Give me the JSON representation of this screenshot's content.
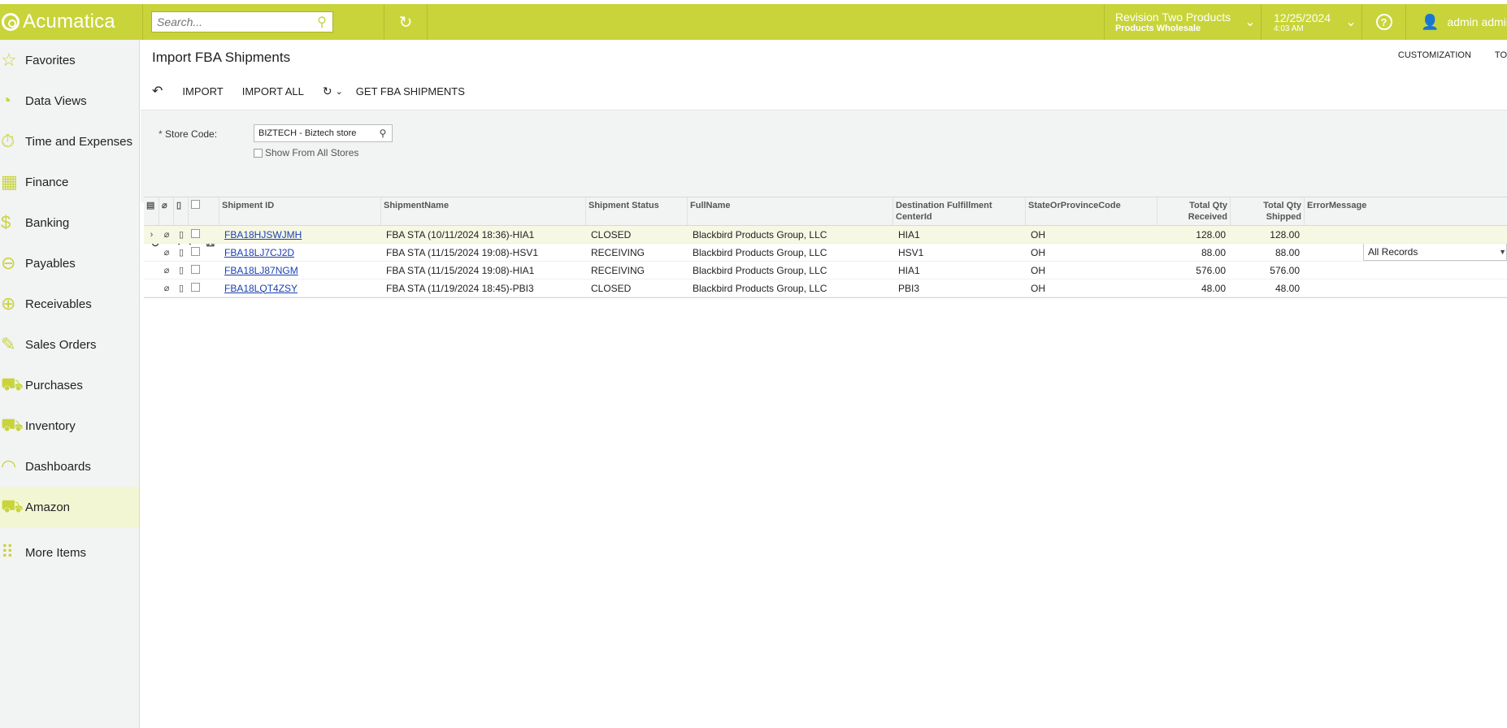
{
  "topbar": {
    "logo": "Acumatica",
    "search_placeholder": "Search...",
    "company": {
      "name": "Revision Two Products",
      "branch": "Products Wholesale"
    },
    "date": {
      "date": "12/25/2024",
      "time": "4:03 AM"
    },
    "user": "admin admin"
  },
  "sidebar": {
    "items": [
      {
        "label": "Favorites",
        "icon": "star-icon",
        "glyph": "☆"
      },
      {
        "label": "Data Views",
        "icon": "pie-chart-icon",
        "glyph": "◔"
      },
      {
        "label": "Time and Expenses",
        "icon": "stopwatch-icon",
        "glyph": "⏱"
      },
      {
        "label": "Finance",
        "icon": "calculator-icon",
        "glyph": "▦"
      },
      {
        "label": "Banking",
        "icon": "dollar-icon",
        "glyph": "$"
      },
      {
        "label": "Payables",
        "icon": "minus-circle-icon",
        "glyph": "⊖"
      },
      {
        "label": "Receivables",
        "icon": "plus-circle-icon",
        "glyph": "⊕"
      },
      {
        "label": "Sales Orders",
        "icon": "edit-icon",
        "glyph": "✎"
      },
      {
        "label": "Purchases",
        "icon": "cart-icon",
        "glyph": "⛟"
      },
      {
        "label": "Inventory",
        "icon": "truck-icon",
        "glyph": "⛟"
      },
      {
        "label": "Dashboards",
        "icon": "gauge-icon",
        "glyph": "◠"
      },
      {
        "label": "Amazon",
        "icon": "cart-icon",
        "glyph": "⛟"
      },
      {
        "label": "More Items",
        "icon": "grid-dots-icon",
        "glyph": "⠿"
      }
    ],
    "active": "Amazon"
  },
  "page": {
    "title": "Import FBA Shipments",
    "header_links": [
      "CUSTOMIZATION",
      "TO"
    ],
    "toolbar": {
      "import": "IMPORT",
      "import_all": "IMPORT ALL",
      "get_fba": "GET FBA SHIPMENTS"
    }
  },
  "form": {
    "store_code_label": "Store Code:",
    "store_code_value": "BIZTECH - Biztech store",
    "show_all_label": "Show From All Stores"
  },
  "grid": {
    "filter": "All Records",
    "columns": [
      "Shipment ID",
      "ShipmentName",
      "Shipment Status",
      "FullName",
      "Destination Fulfillment CenterId",
      "StateOrProvinceCode",
      "Total Qty Received",
      "Total Qty Shipped",
      "ErrorMessage"
    ],
    "rows": [
      {
        "id": "FBA18HJSWJMH",
        "name": "FBA STA (10/11/2024 18:36)-HIA1",
        "status": "CLOSED",
        "full_name": "Blackbird Products Group, LLC",
        "dest": "HIA1",
        "state": "OH",
        "received": "128.00",
        "shipped": "128.00",
        "error": ""
      },
      {
        "id": "FBA18LJ7CJ2D",
        "name": "FBA STA (11/15/2024 19:08)-HSV1",
        "status": "RECEIVING",
        "full_name": "Blackbird Products Group, LLC",
        "dest": "HSV1",
        "state": "OH",
        "received": "88.00",
        "shipped": "88.00",
        "error": ""
      },
      {
        "id": "FBA18LJ87NGM",
        "name": "FBA STA (11/15/2024 19:08)-HIA1",
        "status": "RECEIVING",
        "full_name": "Blackbird Products Group, LLC",
        "dest": "HIA1",
        "state": "OH",
        "received": "576.00",
        "shipped": "576.00",
        "error": ""
      },
      {
        "id": "FBA18LQT4ZSY",
        "name": "FBA STA (11/19/2024 18:45)-PBI3",
        "status": "CLOSED",
        "full_name": "Blackbird Products Group, LLC",
        "dest": "PBI3",
        "state": "OH",
        "received": "48.00",
        "shipped": "48.00",
        "error": ""
      }
    ]
  },
  "colors": {
    "accent": "#c8d43a",
    "sidebar_bg": "#f2f3f3",
    "active_bg": "#f3f6d3",
    "link": "#1a3fb0"
  }
}
